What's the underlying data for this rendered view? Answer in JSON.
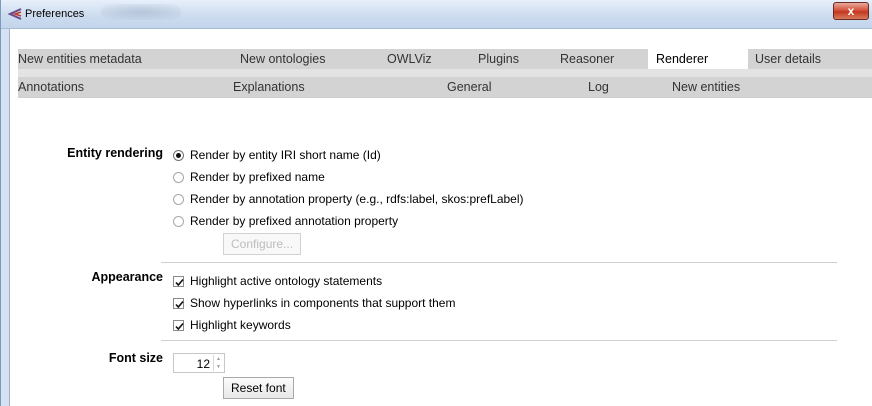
{
  "window": {
    "title": "Preferences",
    "close_label": "x"
  },
  "tabs_row1": [
    {
      "label": "New entities metadata",
      "selected": false
    },
    {
      "label": "New ontologies",
      "selected": false
    },
    {
      "label": "OWLViz",
      "selected": false
    },
    {
      "label": "Plugins",
      "selected": false
    },
    {
      "label": "Reasoner",
      "selected": false
    },
    {
      "label": "Renderer",
      "selected": true
    },
    {
      "label": "User details",
      "selected": false
    }
  ],
  "tabs_row2": [
    {
      "label": "Annotations",
      "selected": false
    },
    {
      "label": "Explanations",
      "selected": false
    },
    {
      "label": "General",
      "selected": false
    },
    {
      "label": "Log",
      "selected": false
    },
    {
      "label": "New entities",
      "selected": false
    }
  ],
  "entity_rendering": {
    "label": "Entity rendering",
    "options": [
      {
        "label": "Render by entity IRI short name (Id)",
        "checked": true,
        "enabled": true
      },
      {
        "label": "Render by prefixed name",
        "checked": false,
        "enabled": true
      },
      {
        "label": "Render by annotation property (e.g., rdfs:label, skos:prefLabel)",
        "checked": false,
        "enabled": true
      },
      {
        "label": "Render by prefixed annotation property",
        "checked": false,
        "enabled": true
      }
    ],
    "configure_label": "Configure..."
  },
  "appearance": {
    "label": "Appearance",
    "options": [
      {
        "label": "Highlight active ontology statements",
        "checked": true
      },
      {
        "label": "Show hyperlinks in components that support them",
        "checked": true
      },
      {
        "label": "Highlight keywords",
        "checked": true
      }
    ]
  },
  "font": {
    "label": "Font size",
    "size": "12",
    "reset_label": "Reset font"
  },
  "colors": {
    "titlebar": "#cddcef",
    "tab_strip": "#d3d3d3",
    "selected_tab": "#ffffff",
    "close_button": "#c2381f"
  }
}
